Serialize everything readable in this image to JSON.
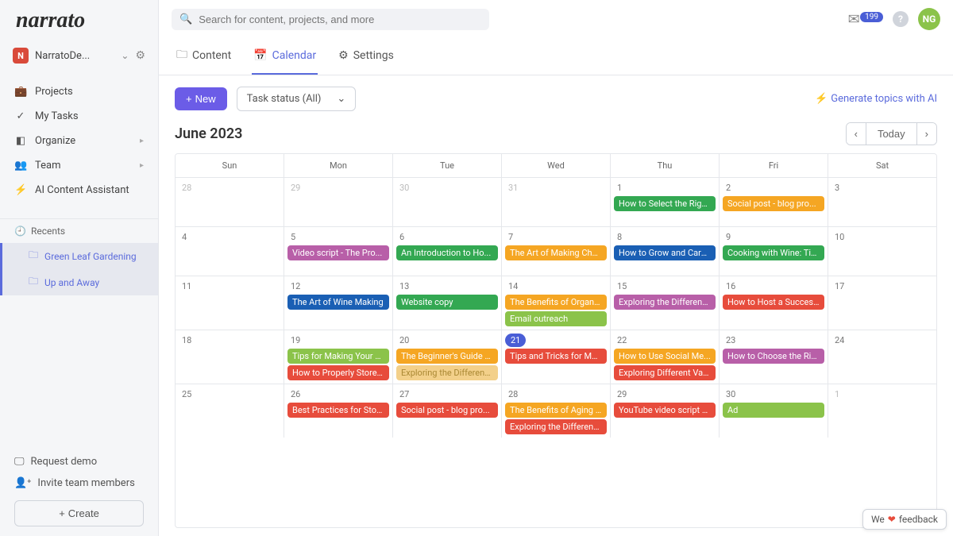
{
  "logo": "narrato",
  "workspace": {
    "initial": "N",
    "name": "NarratoDe..."
  },
  "nav": [
    {
      "icon": "💼",
      "label": "Projects"
    },
    {
      "icon": "✓",
      "label": "My Tasks"
    },
    {
      "icon": "◧",
      "label": "Organize",
      "caret": true
    },
    {
      "icon": "👥",
      "label": "Team",
      "caret": true
    },
    {
      "icon": "⚡",
      "label": "AI Content Assistant",
      "bolt": true
    }
  ],
  "recents": {
    "header": "Recents",
    "items": [
      "Green Leaf Gardening",
      "Up and Away"
    ]
  },
  "footer": {
    "request_demo": "Request demo",
    "invite": "Invite team members",
    "create": "Create"
  },
  "search": {
    "placeholder": "Search for content, projects, and more"
  },
  "notif_count": "199",
  "avatar": "NG",
  "tabs": [
    {
      "icon": "🗀",
      "label": "Content"
    },
    {
      "icon": "📅",
      "label": "Calendar"
    },
    {
      "icon": "⚙",
      "label": "Settings"
    }
  ],
  "toolbar": {
    "new": "New",
    "status": "Task status (All)",
    "generate": "Generate topics with AI"
  },
  "month": "June 2023",
  "today_label": "Today",
  "day_headers": [
    "Sun",
    "Mon",
    "Tue",
    "Wed",
    "Thu",
    "Fri",
    "Sat"
  ],
  "colors": {
    "green": "#33a852",
    "lime": "#8bc34a",
    "blue": "#1a5fb4",
    "orange": "#f5a623",
    "red": "#e74c3c",
    "purple": "#b85fa8",
    "pale": "#f3d08a"
  },
  "weeks": [
    [
      {
        "d": "28",
        "muted": true,
        "events": []
      },
      {
        "d": "29",
        "muted": true,
        "events": []
      },
      {
        "d": "30",
        "muted": true,
        "events": []
      },
      {
        "d": "31",
        "muted": true,
        "events": []
      },
      {
        "d": "1",
        "events": [
          {
            "t": "How to Select the Righ...",
            "c": "green"
          }
        ]
      },
      {
        "d": "2",
        "events": [
          {
            "t": "Social post - blog pro...",
            "c": "orange"
          }
        ]
      },
      {
        "d": "3",
        "events": []
      }
    ],
    [
      {
        "d": "4",
        "events": []
      },
      {
        "d": "5",
        "events": [
          {
            "t": "Video script - The Pro...",
            "c": "purple"
          }
        ]
      },
      {
        "d": "6",
        "events": [
          {
            "t": "An Introduction to Ho...",
            "c": "green"
          }
        ]
      },
      {
        "d": "7",
        "events": [
          {
            "t": "The Art of Making Che...",
            "c": "orange"
          }
        ]
      },
      {
        "d": "8",
        "events": [
          {
            "t": "How to Grow and Care...",
            "c": "blue"
          }
        ]
      },
      {
        "d": "9",
        "events": [
          {
            "t": "Cooking with Wine: Tip...",
            "c": "green"
          }
        ]
      },
      {
        "d": "10",
        "events": []
      }
    ],
    [
      {
        "d": "11",
        "events": []
      },
      {
        "d": "12",
        "events": [
          {
            "t": "The Art of Wine Making",
            "c": "blue"
          }
        ]
      },
      {
        "d": "13",
        "events": [
          {
            "t": "Website copy",
            "c": "green"
          }
        ]
      },
      {
        "d": "14",
        "events": [
          {
            "t": "The Benefits of Organi...",
            "c": "orange"
          },
          {
            "t": "Email outreach",
            "c": "lime"
          }
        ]
      },
      {
        "d": "15",
        "events": [
          {
            "t": "Exploring the Different ...",
            "c": "purple"
          }
        ]
      },
      {
        "d": "16",
        "events": [
          {
            "t": "How to Host a Succes...",
            "c": "red"
          }
        ]
      },
      {
        "d": "17",
        "events": []
      }
    ],
    [
      {
        "d": "18",
        "events": []
      },
      {
        "d": "19",
        "events": [
          {
            "t": "Tips for Making Your O...",
            "c": "lime"
          },
          {
            "t": "How to Properly Store ...",
            "c": "red"
          }
        ]
      },
      {
        "d": "20",
        "events": [
          {
            "t": "The Beginner's Guide t...",
            "c": "orange"
          },
          {
            "t": "Exploring the Different ...",
            "c": "pale"
          }
        ]
      },
      {
        "d": "21",
        "today": true,
        "events": [
          {
            "t": "Tips and Tricks for Ma...",
            "c": "red"
          }
        ]
      },
      {
        "d": "22",
        "events": [
          {
            "t": "How to Use Social Me...",
            "c": "orange"
          },
          {
            "t": "Exploring Different Vari...",
            "c": "red"
          }
        ]
      },
      {
        "d": "23",
        "events": [
          {
            "t": "How to Choose the Rig...",
            "c": "purple"
          }
        ]
      },
      {
        "d": "24",
        "events": []
      }
    ],
    [
      {
        "d": "25",
        "events": []
      },
      {
        "d": "26",
        "events": [
          {
            "t": "Best Practices for Stori...",
            "c": "red"
          }
        ]
      },
      {
        "d": "27",
        "events": [
          {
            "t": "Social post - blog pro...",
            "c": "red"
          }
        ]
      },
      {
        "d": "28",
        "events": [
          {
            "t": "The Benefits of Aging ...",
            "c": "orange"
          },
          {
            "t": "Exploring the Different ...",
            "c": "red"
          }
        ]
      },
      {
        "d": "29",
        "events": [
          {
            "t": "YouTube video script o...",
            "c": "red"
          }
        ]
      },
      {
        "d": "30",
        "events": [
          {
            "t": "Ad",
            "c": "lime"
          }
        ]
      },
      {
        "d": "1",
        "muted": true,
        "events": []
      }
    ]
  ],
  "feedback": {
    "pre": "We",
    "post": "feedback"
  }
}
